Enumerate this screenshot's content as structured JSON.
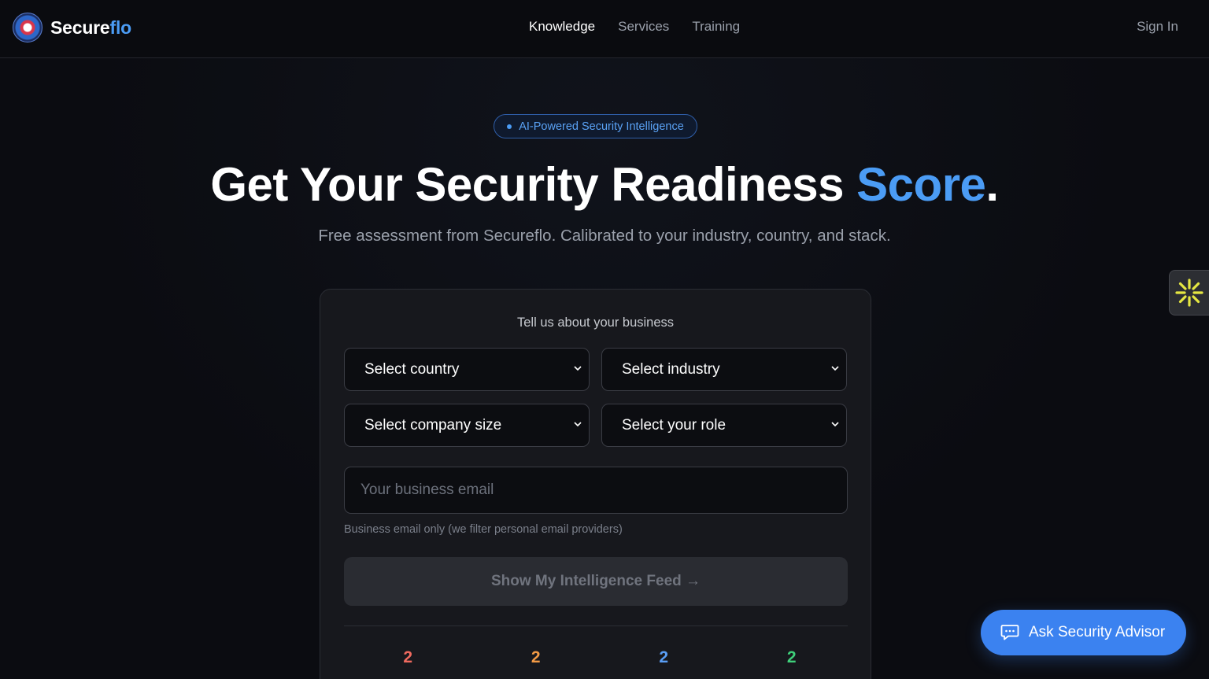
{
  "header": {
    "brand_part1": "Secure",
    "brand_part2": "flo",
    "nav": [
      "Knowledge",
      "Services",
      "Training"
    ],
    "active_nav": "Knowledge",
    "sign_in": "Sign In"
  },
  "hero": {
    "badge": "AI-Powered Security Intelligence",
    "headline_main": "Get Your Security Readiness ",
    "headline_accent": "Score",
    "headline_end": ".",
    "subheadline": "Free assessment from Secureflo. Calibrated to your industry, country, and stack."
  },
  "form": {
    "title": "Tell us about your business",
    "country": "Select country",
    "industry": "Select industry",
    "company_size": "Select company size",
    "role": "Select your role",
    "email_placeholder": "Your business email",
    "email_hint": "Business email only (we filter personal email providers)",
    "submit": "Show My Intelligence Feed →",
    "stats": [
      {
        "value": "2",
        "color": "#f06a5f"
      },
      {
        "value": "2",
        "color": "#f29a45"
      },
      {
        "value": "2",
        "color": "#5a9ef5"
      },
      {
        "value": "2",
        "color": "#3fcf7a"
      }
    ]
  },
  "chat": {
    "label": "Ask Security Advisor",
    "icon": "chat-bubble-icon"
  },
  "side_widget": {
    "icon": "sparkle-icon",
    "color": "#e5e742"
  },
  "colors": {
    "accent": "#4b9cf5",
    "background": "#0c0d12",
    "card": "#17181d"
  }
}
